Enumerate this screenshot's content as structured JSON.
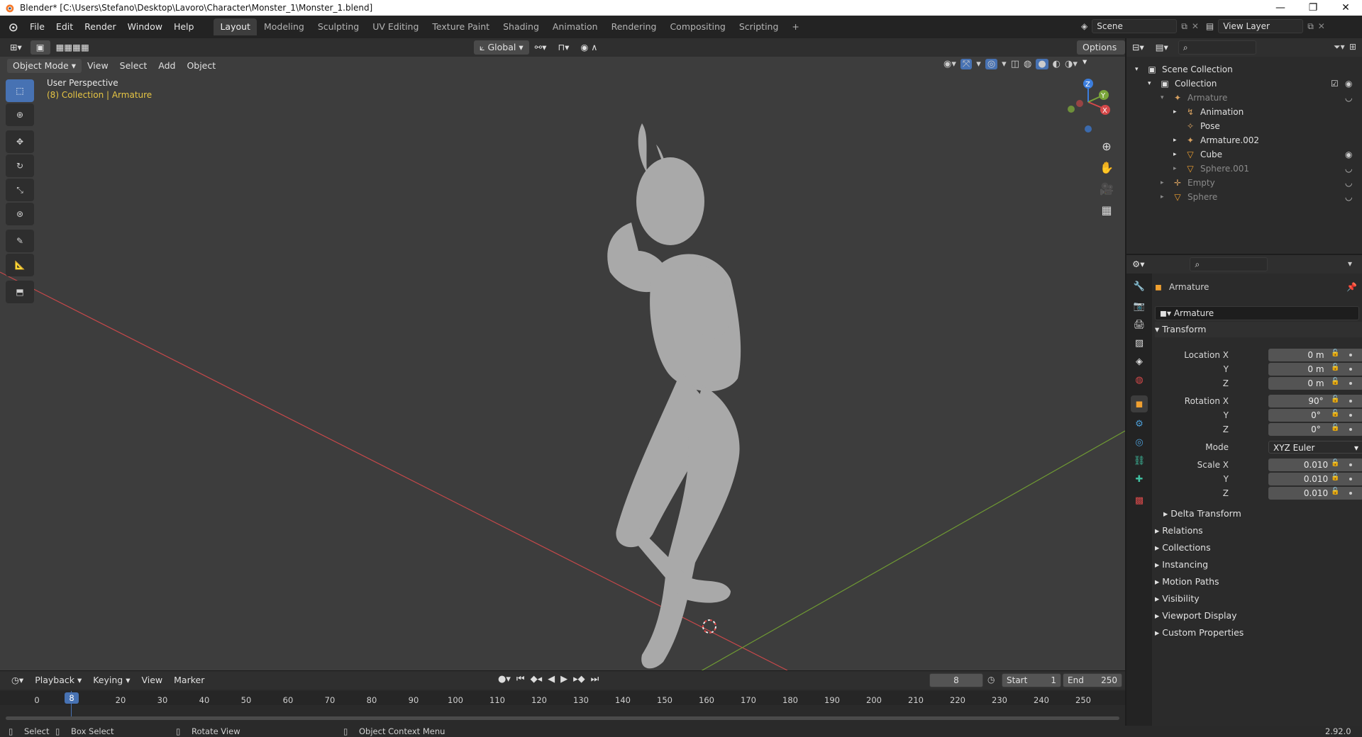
{
  "titlebar": {
    "title": "Blender* [C:\\Users\\Stefano\\Desktop\\Lavoro\\Character\\Monster_1\\Monster_1.blend]"
  },
  "menu": {
    "items": [
      "File",
      "Edit",
      "Render",
      "Window",
      "Help"
    ]
  },
  "workspaces": {
    "tabs": [
      "Layout",
      "Modeling",
      "Sculpting",
      "UV Editing",
      "Texture Paint",
      "Shading",
      "Animation",
      "Rendering",
      "Compositing",
      "Scripting"
    ],
    "active": "Layout",
    "add": "+"
  },
  "scene": {
    "label": "Scene",
    "view_layer": "View Layer"
  },
  "viewport": {
    "mode": "Object Mode",
    "header_menus": [
      "View",
      "Select",
      "Add",
      "Object"
    ],
    "transform_orientation": "Global",
    "options_label": "Options",
    "perspective": "User Perspective",
    "collection_info": "(8) Collection | Armature",
    "gizmo": {
      "z": "Z",
      "y": "Y",
      "x": "X"
    }
  },
  "outliner": {
    "rows": [
      {
        "label": "Scene Collection",
        "indent": 0,
        "icon": "collection-icon",
        "dim": false
      },
      {
        "label": "Collection",
        "indent": 1,
        "icon": "collection-icon",
        "dim": false
      },
      {
        "label": "Armature",
        "indent": 2,
        "icon": "armature-icon",
        "dim": true
      },
      {
        "label": "Animation",
        "indent": 3,
        "icon": "action-icon",
        "dim": false
      },
      {
        "label": "Pose",
        "indent": 3,
        "icon": "pose-icon",
        "dim": false
      },
      {
        "label": "Armature.002",
        "indent": 3,
        "icon": "armature-data-icon",
        "dim": false
      },
      {
        "label": "Cube",
        "indent": 3,
        "icon": "mesh-icon",
        "dim": false
      },
      {
        "label": "Sphere.001",
        "indent": 3,
        "icon": "mesh-icon",
        "dim": true
      },
      {
        "label": "Empty",
        "indent": 2,
        "icon": "empty-icon",
        "dim": true
      },
      {
        "label": "Sphere",
        "indent": 2,
        "icon": "mesh-icon",
        "dim": true
      }
    ]
  },
  "properties": {
    "object_name": "Armature",
    "object_field": "Armature",
    "transform_label": "Transform",
    "location": {
      "label": "Location X",
      "x": "0 m",
      "y": "0 m",
      "z": "0 m"
    },
    "rotation": {
      "label": "Rotation X",
      "x": "90°",
      "y": "0°",
      "z": "0°"
    },
    "mode": {
      "label": "Mode",
      "value": "XYZ Euler"
    },
    "scale": {
      "label": "Scale X",
      "x": "0.010",
      "y": "0.010",
      "z": "0.010"
    },
    "axis_y": "Y",
    "axis_z": "Z",
    "delta_transform": "Delta Transform",
    "panels": [
      "Relations",
      "Collections",
      "Instancing",
      "Motion Paths",
      "Visibility",
      "Viewport Display",
      "Custom Properties"
    ]
  },
  "timeline": {
    "menus": [
      "Playback",
      "Keying",
      "View",
      "Marker"
    ],
    "current_frame": "8",
    "start_label": "Start",
    "start": "1",
    "end_label": "End",
    "end": "250",
    "ticks": [
      "0",
      "8",
      "20",
      "30",
      "40",
      "50",
      "60",
      "70",
      "80",
      "90",
      "100",
      "110",
      "120",
      "130",
      "140",
      "150",
      "160",
      "170",
      "180",
      "190",
      "200",
      "210",
      "220",
      "230",
      "240",
      "250"
    ]
  },
  "statusbar": {
    "select": "Select",
    "box_select": "Box Select",
    "rotate_view": "Rotate View",
    "context_menu": "Object Context Menu",
    "version": "2.92.0"
  },
  "colors": {
    "accent": "#4772b3",
    "x_axis": "#d6494a",
    "y_axis": "#7aa53a",
    "z_axis": "#3b7ddd",
    "viewport_bg": "#3d3d3d",
    "collection_text": "#e6c544"
  }
}
